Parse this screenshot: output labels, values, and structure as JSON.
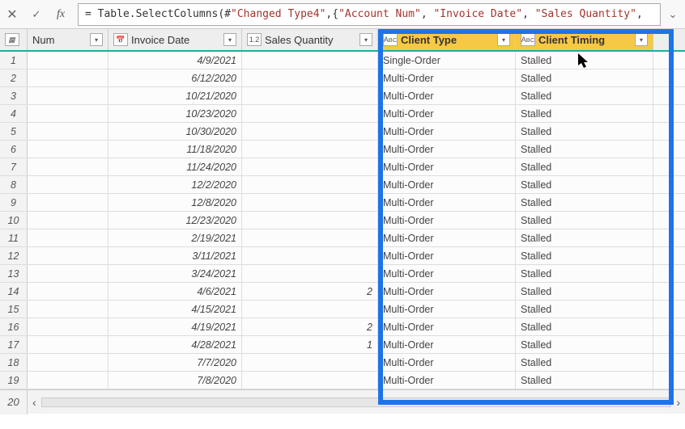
{
  "formula": {
    "prefix": "= Table.SelectColumns(#",
    "args": [
      "\"Changed Type4\"",
      "\"Account Num\"",
      "\"Invoice Date\"",
      "\"Sales Quantity\""
    ]
  },
  "columns": {
    "num": {
      "type": "tbl",
      "label": "Num"
    },
    "date": {
      "type": "cal",
      "label": "Invoice Date"
    },
    "qty": {
      "type": "1.2",
      "label": "Sales Quantity"
    },
    "ctype": {
      "type": "ABC",
      "label": "Client Type"
    },
    "ctime": {
      "type": "ABC",
      "label": "Client Timing"
    }
  },
  "rows": [
    {
      "n": 1,
      "date": "4/9/2021",
      "qty": "",
      "ctype": "Single-Order",
      "ctime": "Stalled"
    },
    {
      "n": 2,
      "date": "6/12/2020",
      "qty": "",
      "ctype": "Multi-Order",
      "ctime": "Stalled"
    },
    {
      "n": 3,
      "date": "10/21/2020",
      "qty": "",
      "ctype": "Multi-Order",
      "ctime": "Stalled"
    },
    {
      "n": 4,
      "date": "10/23/2020",
      "qty": "",
      "ctype": "Multi-Order",
      "ctime": "Stalled"
    },
    {
      "n": 5,
      "date": "10/30/2020",
      "qty": "",
      "ctype": "Multi-Order",
      "ctime": "Stalled"
    },
    {
      "n": 6,
      "date": "11/18/2020",
      "qty": "",
      "ctype": "Multi-Order",
      "ctime": "Stalled"
    },
    {
      "n": 7,
      "date": "11/24/2020",
      "qty": "",
      "ctype": "Multi-Order",
      "ctime": "Stalled"
    },
    {
      "n": 8,
      "date": "12/2/2020",
      "qty": "",
      "ctype": "Multi-Order",
      "ctime": "Stalled"
    },
    {
      "n": 9,
      "date": "12/8/2020",
      "qty": "",
      "ctype": "Multi-Order",
      "ctime": "Stalled"
    },
    {
      "n": 10,
      "date": "12/23/2020",
      "qty": "",
      "ctype": "Multi-Order",
      "ctime": "Stalled"
    },
    {
      "n": 11,
      "date": "2/19/2021",
      "qty": "",
      "ctype": "Multi-Order",
      "ctime": "Stalled"
    },
    {
      "n": 12,
      "date": "3/11/2021",
      "qty": "",
      "ctype": "Multi-Order",
      "ctime": "Stalled"
    },
    {
      "n": 13,
      "date": "3/24/2021",
      "qty": "",
      "ctype": "Multi-Order",
      "ctime": "Stalled"
    },
    {
      "n": 14,
      "date": "4/6/2021",
      "qty": "2",
      "ctype": "Multi-Order",
      "ctime": "Stalled"
    },
    {
      "n": 15,
      "date": "4/15/2021",
      "qty": "",
      "ctype": "Multi-Order",
      "ctime": "Stalled"
    },
    {
      "n": 16,
      "date": "4/19/2021",
      "qty": "2",
      "ctype": "Multi-Order",
      "ctime": "Stalled"
    },
    {
      "n": 17,
      "date": "4/28/2021",
      "qty": "1",
      "ctype": "Multi-Order",
      "ctime": "Stalled"
    },
    {
      "n": 18,
      "date": "7/7/2020",
      "qty": "",
      "ctype": "Multi-Order",
      "ctime": "Stalled"
    },
    {
      "n": 19,
      "date": "7/8/2020",
      "qty": "",
      "ctype": "Multi-Order",
      "ctime": "Stalled"
    }
  ],
  "footer_row_num": 20
}
